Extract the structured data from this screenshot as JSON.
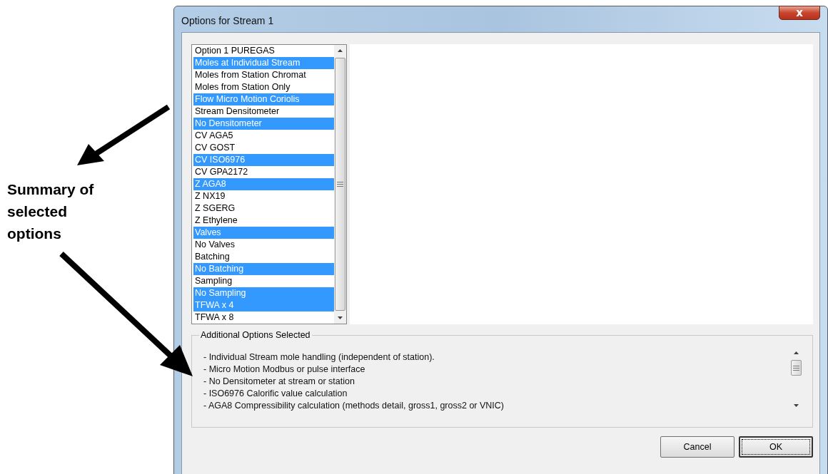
{
  "annotation": {
    "text": "Summary of selected options"
  },
  "window": {
    "title": "Options for Stream 1",
    "close": "x"
  },
  "options": [
    {
      "label": "Option 1 PUREGAS",
      "selected": false
    },
    {
      "label": "Moles at Individual Stream",
      "selected": true
    },
    {
      "label": "Moles from Station Chromat",
      "selected": false
    },
    {
      "label": "Moles from Station Only",
      "selected": false
    },
    {
      "label": "Flow Micro Motion Coriolis",
      "selected": true
    },
    {
      "label": "Stream Densitometer",
      "selected": false
    },
    {
      "label": "No Densitometer",
      "selected": true
    },
    {
      "label": "CV AGA5",
      "selected": false
    },
    {
      "label": "CV GOST",
      "selected": false
    },
    {
      "label": "CV ISO6976",
      "selected": true
    },
    {
      "label": "CV GPA2172",
      "selected": false
    },
    {
      "label": "Z AGA8",
      "selected": true
    },
    {
      "label": "Z NX19",
      "selected": false
    },
    {
      "label": "Z SGERG",
      "selected": false
    },
    {
      "label": "Z Ethylene",
      "selected": false
    },
    {
      "label": "Valves",
      "selected": true
    },
    {
      "label": "No Valves",
      "selected": false
    },
    {
      "label": "Batching",
      "selected": false
    },
    {
      "label": "No Batching",
      "selected": true
    },
    {
      "label": "Sampling",
      "selected": false
    },
    {
      "label": "No Sampling",
      "selected": true
    },
    {
      "label": "TFWA x 4",
      "selected": true
    },
    {
      "label": "TFWA x 8",
      "selected": false
    }
  ],
  "additional_options": {
    "title": "Additional Options Selected",
    "lines": [
      "- Individual Stream mole handling (independent of station).",
      "- Micro Motion Modbus or pulse interface",
      "- No Densitometer at stream or station",
      "- ISO6976 Calorific value calculation",
      "- AGA8 Compressibility calculation (methods detail, gross1, gross2 or VNIC)"
    ]
  },
  "buttons": [
    {
      "label": "Cancel",
      "default": false
    },
    {
      "label": "OK",
      "default": true
    }
  ]
}
